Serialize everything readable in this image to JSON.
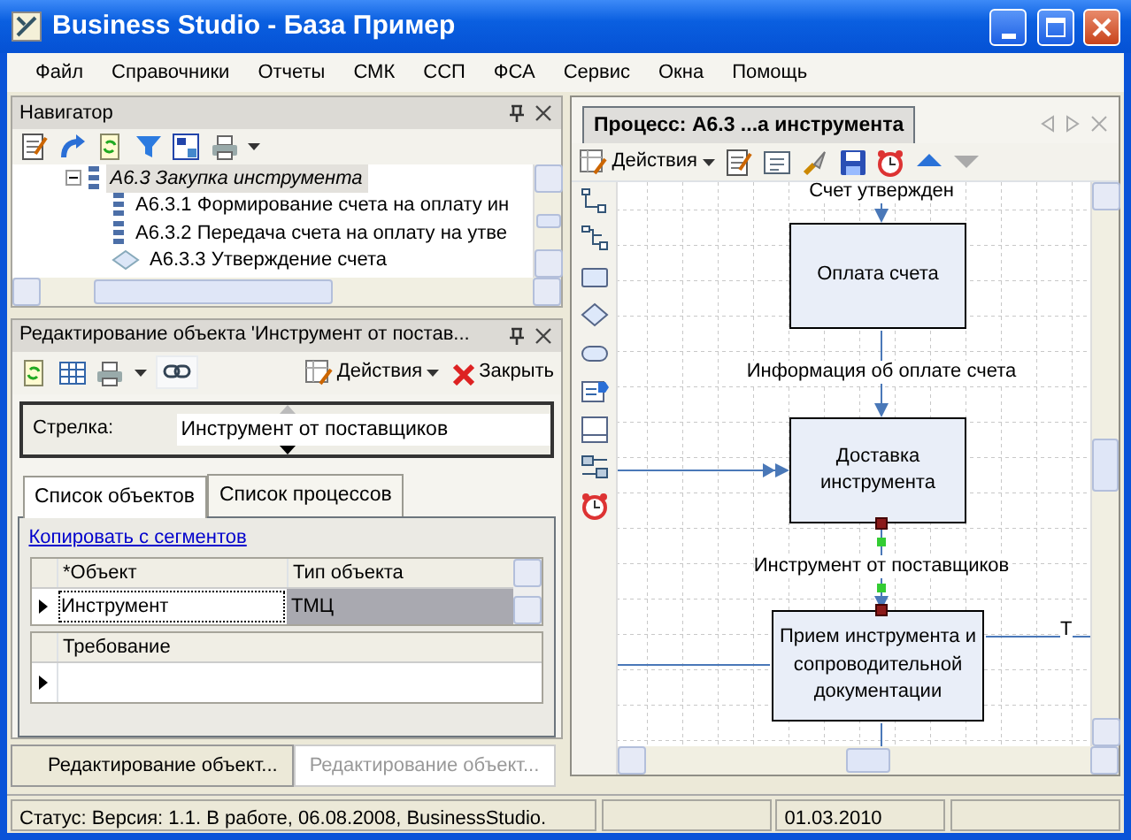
{
  "window": {
    "title": "Business Studio - База Пример"
  },
  "menu": [
    "Файл",
    "Справочники",
    "Отчеты",
    "СМК",
    "ССП",
    "ФСА",
    "Сервис",
    "Окна",
    "Помощь"
  ],
  "navigator": {
    "title": "Навигатор",
    "tree": [
      {
        "label": "А6.3 Закупка инструмента",
        "kind": "process",
        "expanded": true,
        "selected": true,
        "children": [
          {
            "label": "А6.3.1 Формирование счета на оплату ин",
            "kind": "process",
            "selected": false
          },
          {
            "label": "А6.3.2 Передача счета на оплату на утве",
            "kind": "process",
            "selected": false
          },
          {
            "label": "А6.3.3 Утверждение счета",
            "kind": "decision",
            "selected": false
          }
        ]
      }
    ]
  },
  "editor": {
    "title": "Редактирование объекта 'Инструмент от постав...",
    "toolbar": {
      "actions": "Действия",
      "close": "Закрыть"
    },
    "field": {
      "label": "Стрелка:",
      "value": "Инструмент от поставщиков"
    },
    "tabs": [
      {
        "label": "Список объектов",
        "selected": true
      },
      {
        "label": "Список процессов",
        "selected": false
      }
    ],
    "link": "Копировать с сегментов",
    "objects_table": {
      "columns": [
        "*Объект",
        "Тип объекта"
      ],
      "rows": [
        {
          "cells": [
            "Инструмент",
            "ТМЦ"
          ],
          "selected": true
        }
      ]
    },
    "requirements_table": {
      "columns": [
        "Требование"
      ]
    }
  },
  "bottom_tabs": [
    {
      "label": "Редактирование объект...",
      "selected": true
    },
    {
      "label": "Редактирование объект...",
      "selected": false
    }
  ],
  "document": {
    "tab": "Процесс: А6.3 ...а инструмента",
    "toolbar": {
      "actions": "Действия"
    },
    "diagram": {
      "nodes": [
        "Оплата счета",
        "Доставка инструмента",
        "Прием инструмента и сопроводительной документации"
      ],
      "labels": [
        "Счет утвержден",
        "Информация об оплате счета",
        "Инструмент от поставщиков",
        "Т"
      ]
    }
  },
  "status_bar": {
    "text": "Статус: Версия: 1.1. В работе, 06.08.2008, BusinessStudio.",
    "date": "01.03.2010"
  }
}
